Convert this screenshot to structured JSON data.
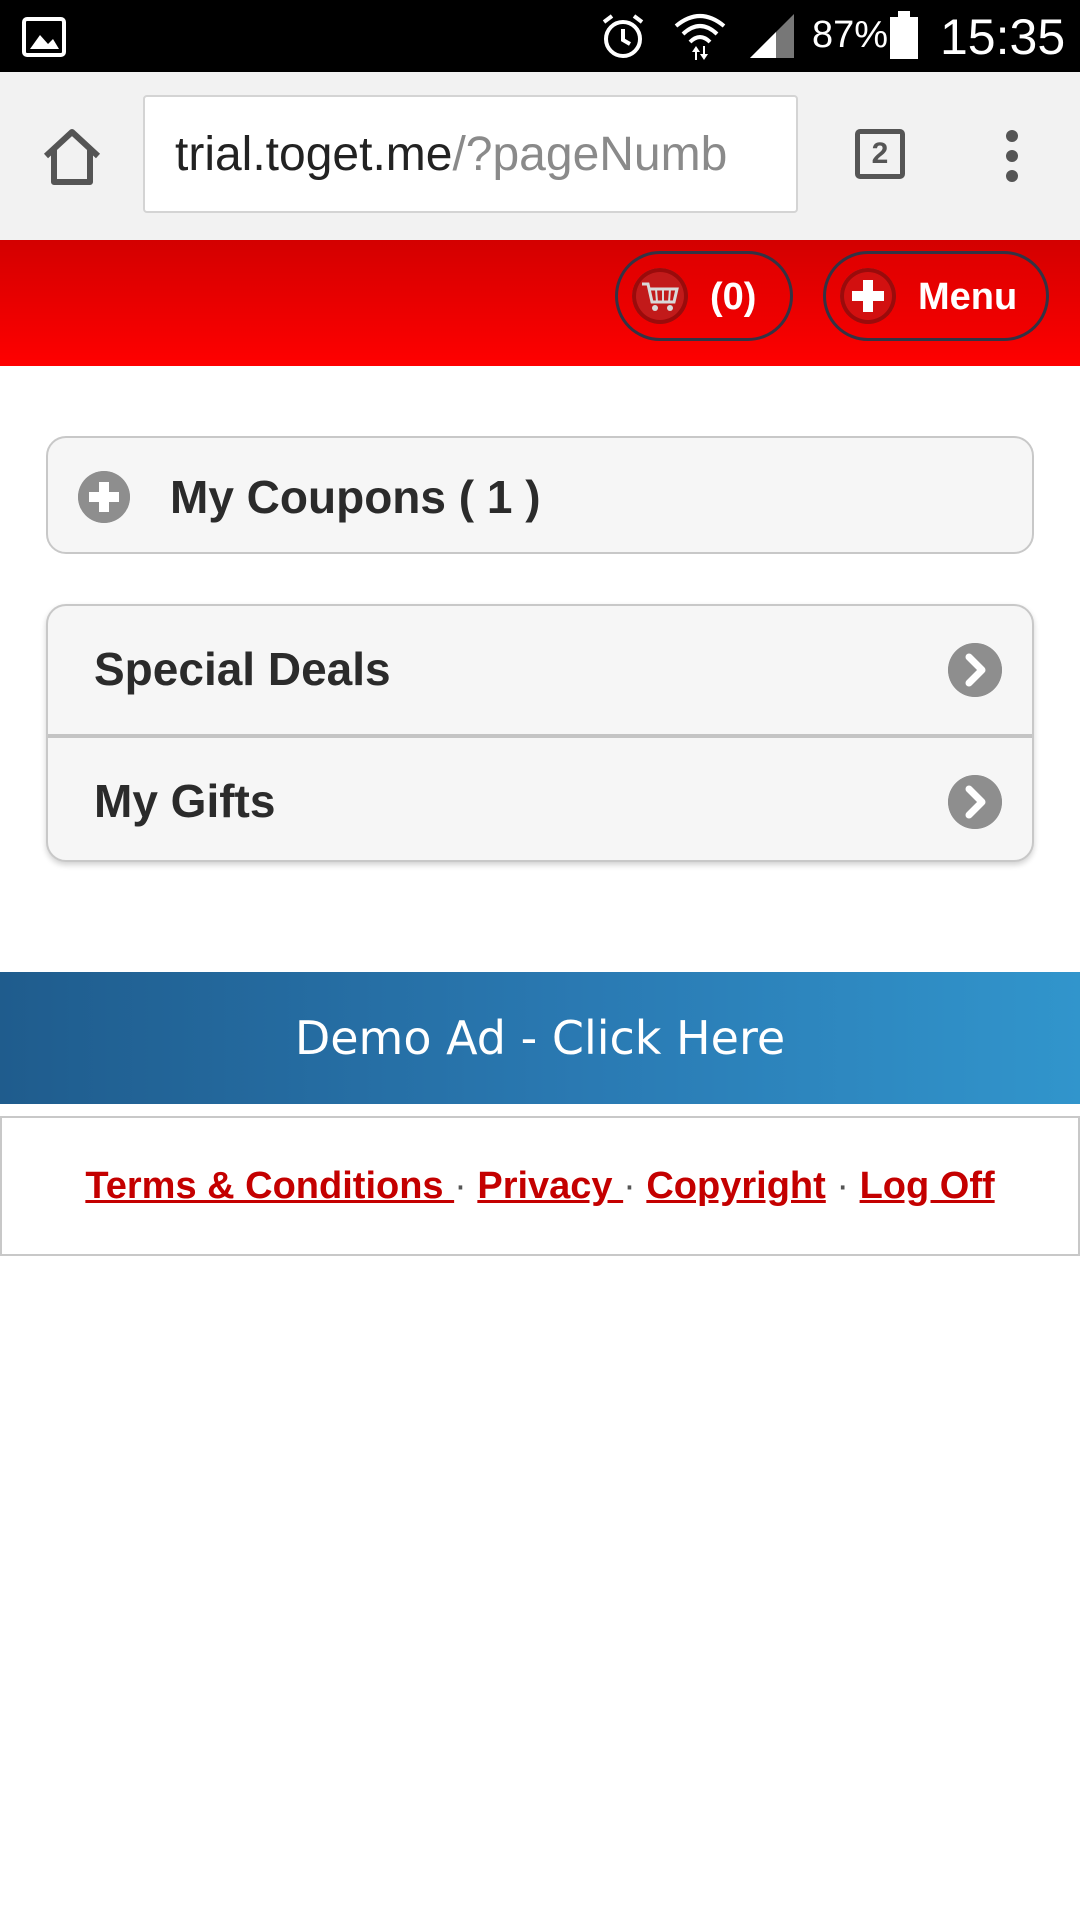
{
  "status_bar": {
    "battery": "87%",
    "time": "15:35",
    "icons": [
      "gallery-icon",
      "alarm-icon",
      "wifi-icon",
      "signal-icon",
      "battery-icon"
    ]
  },
  "browser": {
    "url_host": "trial.toget.me",
    "url_path": "/?pageNumb",
    "tab_count": "2",
    "icons": [
      "home-icon",
      "tabs-icon",
      "overflow-menu-icon"
    ]
  },
  "header": {
    "cart_label": "(0)",
    "menu_label": "Menu",
    "background": "#ff0000",
    "icons": [
      "cart-icon",
      "plus-icon"
    ]
  },
  "main": {
    "coupons_label": "My Coupons ( 1 )",
    "items": [
      {
        "label": "Special Deals"
      },
      {
        "label": "My Gifts"
      }
    ]
  },
  "ad": {
    "text": "Demo Ad - Click Here",
    "color": "#2a7ab3"
  },
  "footer": {
    "terms": "Terms & Conditions ",
    "privacy": "Privacy ",
    "copyright": "Copyright",
    "logoff": "Log Off",
    "separator": "·",
    "link_color": "#c40000"
  }
}
